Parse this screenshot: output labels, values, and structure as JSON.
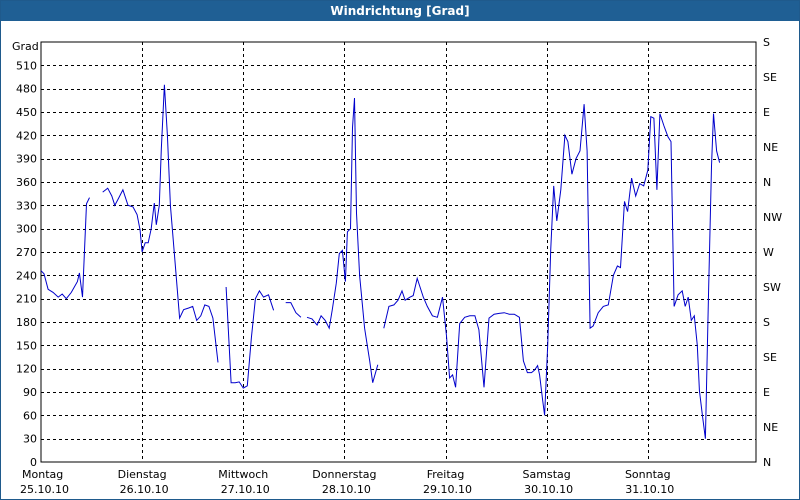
{
  "window": {
    "title": "Windrichtung [Grad]"
  },
  "chart_data": {
    "type": "line",
    "title": "Windrichtung [Grad]",
    "ylabel": "Grad",
    "ylim": [
      0,
      540
    ],
    "yticks": [
      0,
      30,
      60,
      90,
      120,
      150,
      180,
      210,
      240,
      270,
      300,
      330,
      360,
      390,
      420,
      450,
      480,
      510
    ],
    "right_axis_labels": [
      "N",
      "NE",
      "E",
      "SE",
      "S",
      "SW",
      "W",
      "NW",
      "N",
      "NE",
      "E",
      "SE",
      "S"
    ],
    "right_axis_values": [
      0,
      30,
      60,
      90,
      120,
      150,
      180,
      210,
      240,
      270,
      300,
      330,
      360,
      390,
      420,
      450,
      480,
      510,
      540
    ],
    "right_axis_text": [
      "N",
      "NE",
      "E",
      "SE",
      "S",
      "SW",
      "W",
      "NW",
      "N",
      "NE",
      "E",
      "SE",
      "S"
    ],
    "x_range": [
      0,
      7.07
    ],
    "x_days": [
      {
        "day": "Montag",
        "date": "25.10.10"
      },
      {
        "day": "Dienstag",
        "date": "26.10.10"
      },
      {
        "day": "Mittwoch",
        "date": "27.10.10"
      },
      {
        "day": "Donnerstag",
        "date": "28.10.10"
      },
      {
        "day": "Freitag",
        "date": "29.10.10"
      },
      {
        "day": "Samstag",
        "date": "30.10.10"
      },
      {
        "day": "Sonntag",
        "date": "31.10.10"
      }
    ],
    "series_color": "#0000cc",
    "grid": true,
    "points": [
      [
        0.0,
        246
      ],
      [
        0.03,
        242
      ],
      [
        0.07,
        222
      ],
      [
        0.12,
        218
      ],
      [
        0.17,
        212
      ],
      [
        0.21,
        216
      ],
      [
        0.25,
        210
      ],
      [
        0.3,
        218
      ],
      [
        0.36,
        232
      ],
      [
        0.38,
        243
      ],
      [
        0.41,
        212
      ],
      [
        0.45,
        332
      ],
      [
        0.48,
        340
      ],
      [
        0.54,
        344
      ],
      [
        0.61,
        347
      ],
      [
        0.66,
        352
      ],
      [
        0.7,
        342
      ],
      [
        0.73,
        330
      ],
      [
        0.77,
        340
      ],
      [
        0.81,
        350
      ],
      [
        0.86,
        330
      ],
      [
        0.91,
        328
      ],
      [
        0.95,
        318
      ],
      [
        0.98,
        298
      ],
      [
        1.0,
        270
      ],
      [
        1.03,
        282
      ],
      [
        1.06,
        282
      ],
      [
        1.09,
        300
      ],
      [
        1.12,
        333
      ],
      [
        1.14,
        305
      ],
      [
        1.17,
        330
      ],
      [
        1.19,
        402
      ],
      [
        1.22,
        485
      ],
      [
        1.25,
        420
      ],
      [
        1.28,
        330
      ],
      [
        1.33,
        250
      ],
      [
        1.37,
        185
      ],
      [
        1.41,
        196
      ],
      [
        1.46,
        198
      ],
      [
        1.5,
        200
      ],
      [
        1.54,
        182
      ],
      [
        1.58,
        188
      ],
      [
        1.62,
        202
      ],
      [
        1.66,
        200
      ],
      [
        1.7,
        185
      ],
      [
        1.75,
        128
      ],
      [
        1.83,
        225
      ],
      [
        1.88,
        102
      ],
      [
        1.92,
        102
      ],
      [
        1.96,
        103
      ],
      [
        2.0,
        95
      ],
      [
        2.04,
        98
      ],
      [
        2.08,
        160
      ],
      [
        2.12,
        210
      ],
      [
        2.16,
        220
      ],
      [
        2.2,
        212
      ],
      [
        2.25,
        215
      ],
      [
        2.3,
        195
      ],
      [
        2.36,
        205
      ],
      [
        2.42,
        205
      ],
      [
        2.47,
        205
      ],
      [
        2.52,
        192
      ],
      [
        2.57,
        186
      ],
      [
        2.63,
        186
      ],
      [
        2.68,
        184
      ],
      [
        2.73,
        176
      ],
      [
        2.77,
        188
      ],
      [
        2.81,
        182
      ],
      [
        2.85,
        172
      ],
      [
        2.88,
        196
      ],
      [
        2.92,
        230
      ],
      [
        2.95,
        268
      ],
      [
        2.98,
        272
      ],
      [
        3.01,
        232
      ],
      [
        3.03,
        296
      ],
      [
        3.06,
        300
      ],
      [
        3.08,
        430
      ],
      [
        3.1,
        468
      ],
      [
        3.12,
        320
      ],
      [
        3.15,
        240
      ],
      [
        3.2,
        172
      ],
      [
        3.25,
        130
      ],
      [
        3.28,
        102
      ],
      [
        3.33,
        125
      ],
      [
        3.39,
        172
      ],
      [
        3.44,
        200
      ],
      [
        3.49,
        202
      ],
      [
        3.53,
        208
      ],
      [
        3.57,
        220
      ],
      [
        3.6,
        208
      ],
      [
        3.65,
        212
      ],
      [
        3.68,
        214
      ],
      [
        3.72,
        236
      ],
      [
        3.78,
        212
      ],
      [
        3.82,
        200
      ],
      [
        3.87,
        188
      ],
      [
        3.92,
        186
      ],
      [
        3.97,
        212
      ],
      [
        4.01,
        162
      ],
      [
        4.04,
        108
      ],
      [
        4.07,
        112
      ],
      [
        4.1,
        96
      ],
      [
        4.14,
        178
      ],
      [
        4.19,
        186
      ],
      [
        4.24,
        188
      ],
      [
        4.29,
        188
      ],
      [
        4.33,
        170
      ],
      [
        4.38,
        96
      ],
      [
        4.43,
        185
      ],
      [
        4.48,
        190
      ],
      [
        4.53,
        191
      ],
      [
        4.58,
        192
      ],
      [
        4.63,
        190
      ],
      [
        4.68,
        190
      ],
      [
        4.73,
        186
      ],
      [
        4.77,
        130
      ],
      [
        4.81,
        115
      ],
      [
        4.85,
        115
      ],
      [
        4.88,
        118
      ],
      [
        4.91,
        124
      ],
      [
        4.93,
        112
      ],
      [
        4.96,
        80
      ],
      [
        4.98,
        60
      ],
      [
        5.01,
        150
      ],
      [
        5.04,
        272
      ],
      [
        5.07,
        355
      ],
      [
        5.1,
        310
      ],
      [
        5.14,
        350
      ],
      [
        5.18,
        420
      ],
      [
        5.21,
        412
      ],
      [
        5.25,
        370
      ],
      [
        5.29,
        390
      ],
      [
        5.33,
        400
      ],
      [
        5.37,
        460
      ],
      [
        5.4,
        400
      ],
      [
        5.43,
        172
      ],
      [
        5.46,
        175
      ],
      [
        5.51,
        192
      ],
      [
        5.56,
        200
      ],
      [
        5.61,
        202
      ],
      [
        5.66,
        240
      ],
      [
        5.7,
        252
      ],
      [
        5.73,
        250
      ],
      [
        5.77,
        335
      ],
      [
        5.8,
        322
      ],
      [
        5.84,
        365
      ],
      [
        5.88,
        342
      ],
      [
        5.92,
        358
      ],
      [
        5.96,
        355
      ],
      [
        6.0,
        375
      ],
      [
        6.03,
        444
      ],
      [
        6.06,
        442
      ],
      [
        6.09,
        350
      ],
      [
        6.12,
        448
      ],
      [
        6.16,
        432
      ],
      [
        6.2,
        418
      ],
      [
        6.23,
        412
      ],
      [
        6.26,
        200
      ],
      [
        6.3,
        215
      ],
      [
        6.34,
        220
      ],
      [
        6.37,
        200
      ],
      [
        6.4,
        212
      ],
      [
        6.43,
        182
      ],
      [
        6.46,
        188
      ],
      [
        6.49,
        150
      ],
      [
        6.51,
        92
      ],
      [
        6.54,
        60
      ],
      [
        6.57,
        30
      ],
      [
        6.6,
        215
      ],
      [
        6.63,
        380
      ],
      [
        6.65,
        448
      ],
      [
        6.68,
        400
      ],
      [
        6.71,
        385
      ]
    ]
  }
}
